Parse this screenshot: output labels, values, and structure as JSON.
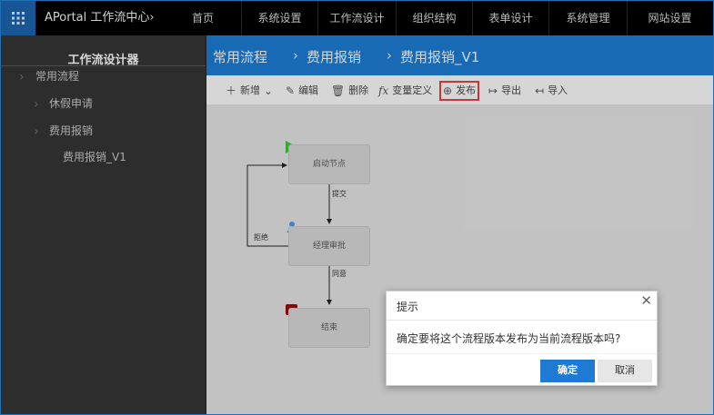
{
  "app": {
    "title": "APortal 工作流中心›"
  },
  "nav": [
    {
      "label": "首页"
    },
    {
      "label": "系统设置"
    },
    {
      "label": "工作流设计"
    },
    {
      "label": "组织结构"
    },
    {
      "label": "表单设计"
    },
    {
      "label": "系统管理"
    },
    {
      "label": "网站设置"
    }
  ],
  "sidebar": {
    "title": "工作流设计器",
    "items": [
      {
        "label": "常用流程"
      },
      {
        "label": "休假申请"
      },
      {
        "label": "费用报销"
      },
      {
        "label": "费用报销_V1"
      }
    ]
  },
  "breadcrumb": [
    "常用流程",
    "费用报销",
    "费用报销_V1"
  ],
  "toolbar": {
    "add": "新增",
    "edit": "编辑",
    "delete": "删除",
    "variables": "变量定义",
    "publish": "发布",
    "export": "导出",
    "import": "导入"
  },
  "diagram": {
    "nodes": [
      {
        "label": "启动节点"
      },
      {
        "label": "经理审批"
      },
      {
        "label": "结束"
      }
    ],
    "edges": [
      {
        "label": "提交"
      },
      {
        "label": "同意"
      },
      {
        "label": "拒绝"
      }
    ]
  },
  "dialog": {
    "title": "提示",
    "message": "确定要将这个流程版本发布为当前流程版本吗?",
    "ok": "确定",
    "cancel": "取消",
    "close_icon": "close-icon"
  },
  "colors": {
    "brand": "#1b76c9",
    "topbar": "#000000",
    "sidebar": "#333333",
    "ok_button": "#1f7bd1",
    "highlight": "#e23b3b"
  }
}
